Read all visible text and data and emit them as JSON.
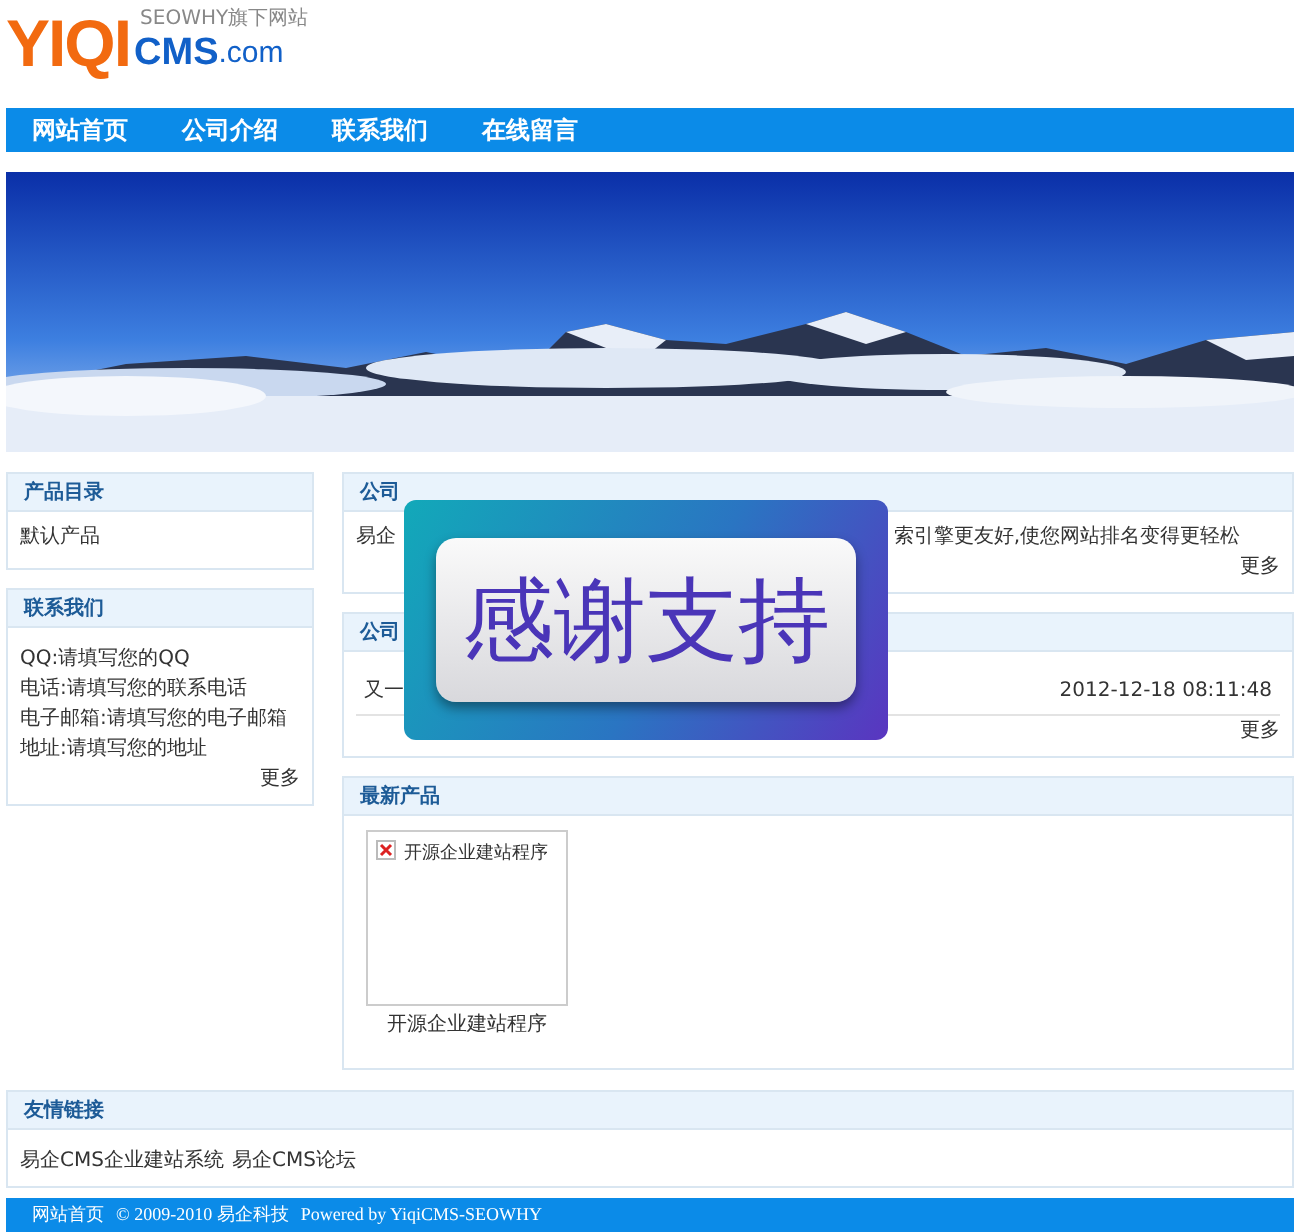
{
  "logo": {
    "brand": "YIQI",
    "product": "CMS",
    "domain": ".com",
    "tagline": "SEOWHY旗下网站"
  },
  "nav": [
    {
      "label": "网站首页"
    },
    {
      "label": "公司介绍"
    },
    {
      "label": "联系我们"
    },
    {
      "label": "在线留言"
    }
  ],
  "sidebar": [
    {
      "title": "产品目录",
      "lines": [
        "默认产品"
      ]
    },
    {
      "title": "联系我们",
      "lines": [
        "QQ:请填写您的QQ",
        "电话:请填写您的联系电话",
        "电子邮箱:请填写您的电子邮箱",
        "地址:请填写您的地址"
      ],
      "more": "更多"
    }
  ],
  "intro": {
    "title": "公司",
    "text_start": "易企",
    "text_end": "索引擎更友好,使您网站排名变得更轻松",
    "more": "更多"
  },
  "news": {
    "title": "公司",
    "items": [
      {
        "title": "又一",
        "date": "2012-12-18 08:11:48"
      }
    ],
    "more": "更多"
  },
  "products": {
    "title": "最新产品",
    "items": [
      {
        "alt": "开源企业建站程序",
        "name": "开源企业建站程序"
      }
    ]
  },
  "links": {
    "title": "友情链接",
    "items": [
      "易企CMS企业建站系统",
      "易企CMS论坛"
    ]
  },
  "footer": {
    "home": "网站首页",
    "copyright": "© 2009-2010 易企科技",
    "powered": "Powered by YiqiCMS-SEOWHY"
  },
  "overlay": {
    "text": "感谢支持"
  }
}
